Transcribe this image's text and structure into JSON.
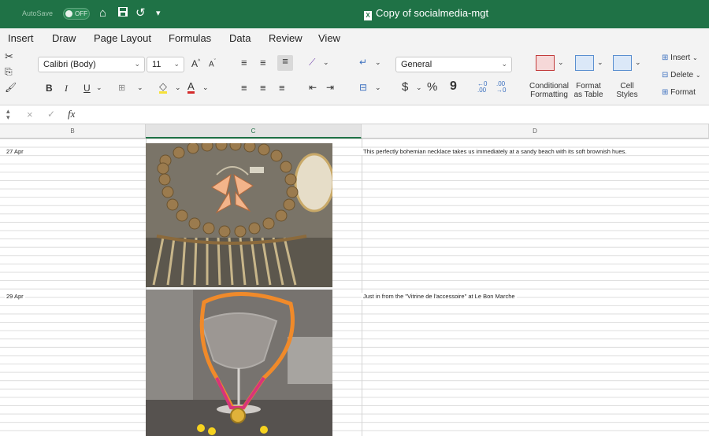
{
  "titlebar": {
    "autosave_label": "AutoSave",
    "autosave_state": "OFF",
    "doc_title": "Copy of socialmedia-mgt"
  },
  "menu": {
    "tabs": [
      "Insert",
      "Draw",
      "Page Layout",
      "Formulas",
      "Data",
      "Review",
      "View"
    ]
  },
  "ribbon": {
    "font_name": "Calibri (Body)",
    "font_size": "11",
    "bold": "B",
    "italic": "I",
    "underline": "U",
    "increase_font": "A",
    "decrease_font": "A",
    "number_format": "General",
    "currency": "$",
    "percent": "%",
    "comma": "9",
    "conditional_formatting": "Conditional\nFormatting",
    "format_as_table": "Format\nas Table",
    "cell_styles": "Cell\nStyles",
    "insert": "Insert",
    "delete": "Delete",
    "format": "Format"
  },
  "formula_bar": {
    "fx": "fx",
    "value": ""
  },
  "grid": {
    "columns": [
      "B",
      "C",
      "D"
    ],
    "rows": [
      {
        "date": "27 Apr",
        "caption": "This perfectly bohemian necklace takes us immediately at a sandy beach with its soft brownish hues."
      },
      {
        "date": "29 Apr",
        "caption": "Just in from the \"Vitrine de l'accessoire\" at Le Bon Marche"
      }
    ]
  },
  "colors": {
    "excel_green": "#1f7246",
    "ribbon_bg": "#f3f3f3",
    "necklace_orange": "#f08a2a",
    "necklace_pink": "#d8347a"
  }
}
